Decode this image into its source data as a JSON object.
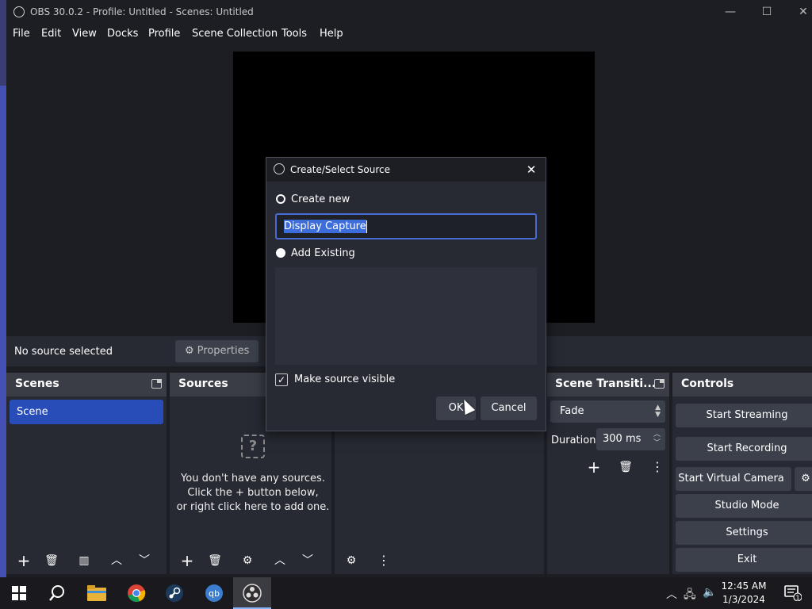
{
  "window": {
    "title": "OBS 30.0.2 - Profile: Untitled - Scenes: Untitled",
    "minimize": "—",
    "maximize": "☐",
    "close": "✕"
  },
  "menu": [
    "File",
    "Edit",
    "View",
    "Docks",
    "Profile",
    "Scene Collection",
    "Tools",
    "Help"
  ],
  "context_bar": {
    "no_source": "No source selected",
    "properties": "Properties"
  },
  "scenes": {
    "title": "Scenes",
    "items": [
      "Scene"
    ]
  },
  "sources": {
    "title": "Sources",
    "empty_line1": "You don't have any sources.",
    "empty_line2": "Click the + button below,",
    "empty_line3": "or right click here to add one."
  },
  "transitions": {
    "title": "Scene Transiti...",
    "selected": "Fade",
    "duration_label": "Duration",
    "duration_value": "300 ms"
  },
  "controls": {
    "title": "Controls",
    "start_streaming": "Start Streaming",
    "start_recording": "Start Recording",
    "start_virtual_camera": "Start Virtual Camera",
    "studio_mode": "Studio Mode",
    "settings": "Settings",
    "exit": "Exit"
  },
  "dialog": {
    "title": "Create/Select Source",
    "create_new": "Create new",
    "name_value": "Display Capture",
    "add_existing": "Add Existing",
    "make_visible": "Make source visible",
    "make_visible_checked": true,
    "ok": "OK",
    "cancel": "Cancel"
  },
  "taskbar": {
    "time": "12:45 AM",
    "date": "1/3/2024",
    "notification_count": "1"
  },
  "colors": {
    "accent_blue": "#284cb8",
    "panel": "#272a33",
    "header": "#3a3d46",
    "button": "#3c404b"
  }
}
